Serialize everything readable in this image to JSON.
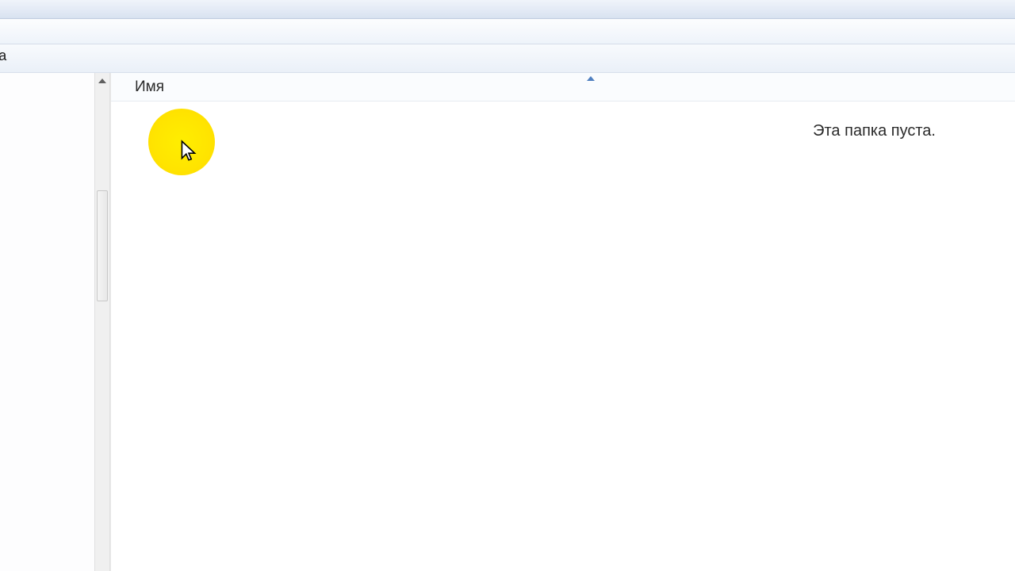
{
  "toolbar": {
    "partial_text": "ка"
  },
  "columns": {
    "name_header": "Имя"
  },
  "content": {
    "empty_message": "Эта папка пуста."
  }
}
